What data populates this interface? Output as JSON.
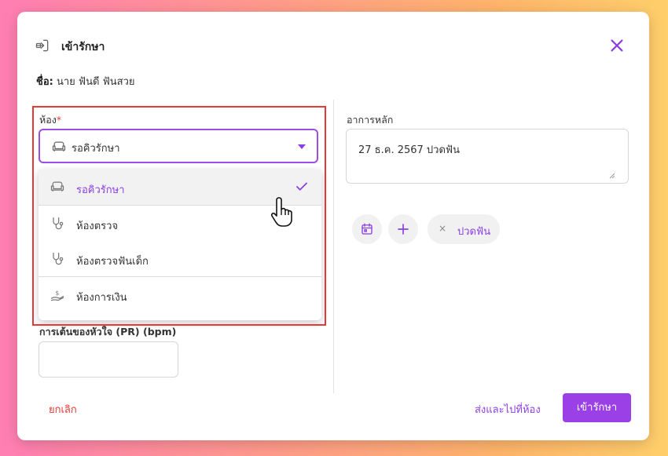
{
  "modal": {
    "title": "เข้ารักษา",
    "name_label": "ชื่อ:",
    "name_value": "นาย ฟันดี ฟันสวย"
  },
  "room": {
    "label": "ห้อง",
    "required_mark": "*",
    "selected": "รอคิวรักษา",
    "options": [
      {
        "label": "รอคิวรักษา",
        "icon": "sofa-icon",
        "selected": true
      },
      {
        "label": "ห้องตรวจ",
        "icon": "stethoscope-icon",
        "selected": false
      },
      {
        "label": "ห้องตรวจฟันเด็ก",
        "icon": "stethoscope-icon",
        "selected": false
      },
      {
        "label": "ห้องการเงิน",
        "icon": "hand-money-icon",
        "selected": false
      }
    ]
  },
  "pulse": {
    "label": "การเต้นของหัวใจ (PR) (bpm)",
    "value": ""
  },
  "symptom": {
    "label": "อาการหลัก",
    "value": "27 ธ.ค. 2567 ปวดฟัน"
  },
  "chips": [
    {
      "label": "ปวดฟัน",
      "remove": "×"
    }
  ],
  "footer": {
    "cancel": "ยกเลิก",
    "send": "ส่งและไปที่ห้อง",
    "primary": "เข้ารักษา"
  },
  "colors": {
    "accent": "#9b3fe6",
    "danger": "#e53935"
  }
}
